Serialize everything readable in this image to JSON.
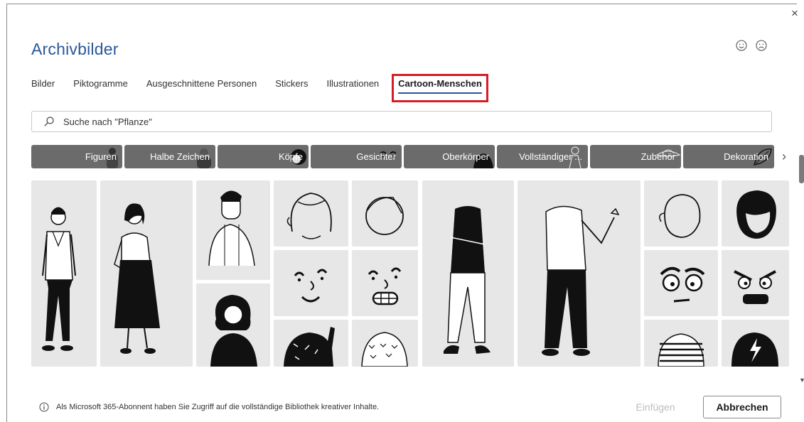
{
  "dialog": {
    "title": "Archivbilder",
    "close_symbol": "×"
  },
  "feedback": {
    "happy_icon": "smiley-icon",
    "sad_icon": "frown-icon"
  },
  "tabs": [
    {
      "label": "Bilder"
    },
    {
      "label": "Piktogramme"
    },
    {
      "label": "Ausgeschnittene Personen"
    },
    {
      "label": "Stickers"
    },
    {
      "label": "Illustrationen"
    },
    {
      "label": "Cartoon-Menschen",
      "active": true
    }
  ],
  "search": {
    "placeholder": "Suche nach \"Pflanze\""
  },
  "categories": [
    {
      "label": "Figuren"
    },
    {
      "label": "Halbe Zeichen"
    },
    {
      "label": "Köpfe"
    },
    {
      "label": "Gesichter"
    },
    {
      "label": "Oberkörper"
    },
    {
      "label": "Vollständiger ..."
    },
    {
      "label": "Zubehör"
    },
    {
      "label": "Dekoration"
    }
  ],
  "chips_next_symbol": "›",
  "footer": {
    "note": "Als Microsoft 365-Abonnent haben Sie Zugriff auf die vollständige Bibliothek kreativer Inhalte.",
    "insert_label": "Einfügen",
    "cancel_label": "Abbrechen"
  },
  "colors": {
    "accent": "#2b579a",
    "highlight_box": "#d51d25",
    "chip_bg": "#6b6b6b",
    "tile_bg": "#e7e7e7"
  }
}
